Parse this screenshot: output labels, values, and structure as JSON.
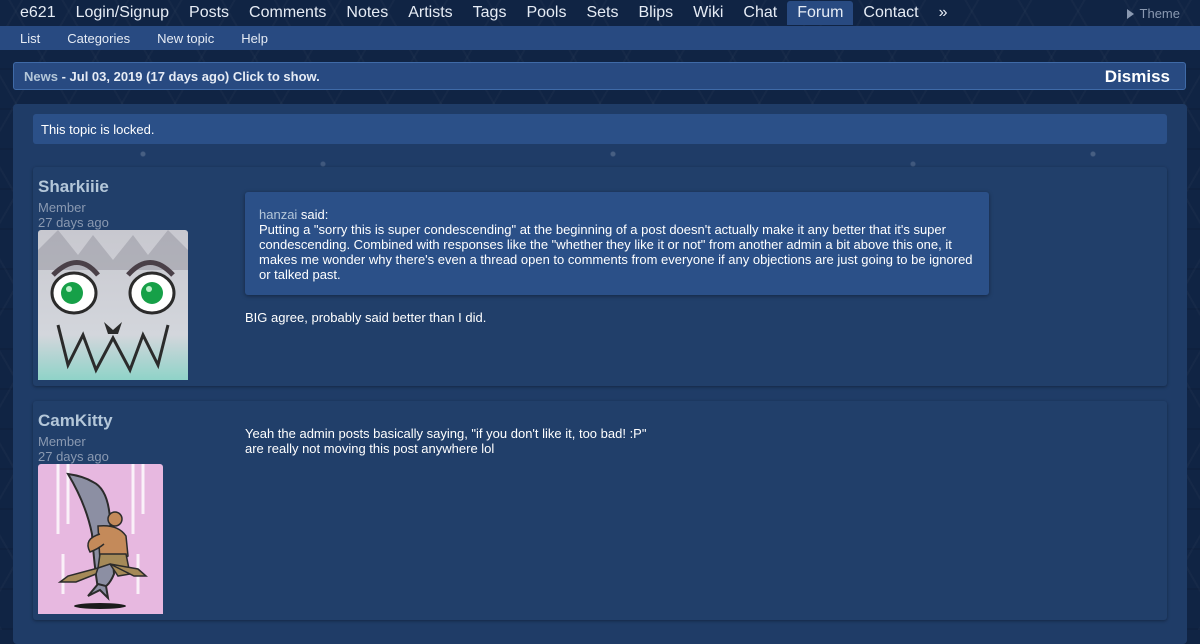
{
  "topnav": {
    "items": [
      {
        "label": "e621"
      },
      {
        "label": "Login/Signup"
      },
      {
        "label": "Posts"
      },
      {
        "label": "Comments"
      },
      {
        "label": "Notes"
      },
      {
        "label": "Artists"
      },
      {
        "label": "Tags"
      },
      {
        "label": "Pools"
      },
      {
        "label": "Sets"
      },
      {
        "label": "Blips"
      },
      {
        "label": "Wiki"
      },
      {
        "label": "Chat"
      },
      {
        "label": "Forum",
        "active": true
      },
      {
        "label": "Contact"
      },
      {
        "label": "»"
      }
    ],
    "theme_label": "Theme"
  },
  "subnav": {
    "items": [
      {
        "label": "List"
      },
      {
        "label": "Categories"
      },
      {
        "label": "New topic"
      },
      {
        "label": "Help"
      }
    ]
  },
  "news": {
    "label": "News",
    "text": " - Jul 03, 2019 (17 days ago) Click to show.",
    "dismiss_label": "Dismiss"
  },
  "topic": {
    "locked_text": "This topic is locked."
  },
  "posts": [
    {
      "author": "Sharkiiie",
      "level": "Member",
      "time": "27 days ago",
      "avatar_icon": "shark-face-avatar",
      "quote": {
        "author": "hanzai",
        "said": " said:",
        "text": "Putting a \"sorry this is super condescending\" at the beginning of a post doesn't actually make it any better that it's super condescending. Combined with responses like the \"whether they like it or not\" from another admin a bit above this one, it makes me wonder why there's even a thread open to comments from everyone if any objections are just going to be ignored or talked past."
      },
      "body": [
        "BIG agree, probably said better than I did."
      ]
    },
    {
      "author": "CamKitty",
      "level": "Member",
      "time": "27 days ago",
      "avatar_icon": "man-hugging-shark-avatar",
      "body": [
        "Yeah the admin posts basically saying, \"if you don't like it, too bad! :P\"",
        "are really not moving this post anywhere lol"
      ]
    }
  ],
  "colors": {
    "background": "#102444",
    "bar": "#284a81",
    "panel": "#1f3c67",
    "post": "#213f6a",
    "link": "#b4c7d9",
    "muted": "#8a99b1"
  }
}
